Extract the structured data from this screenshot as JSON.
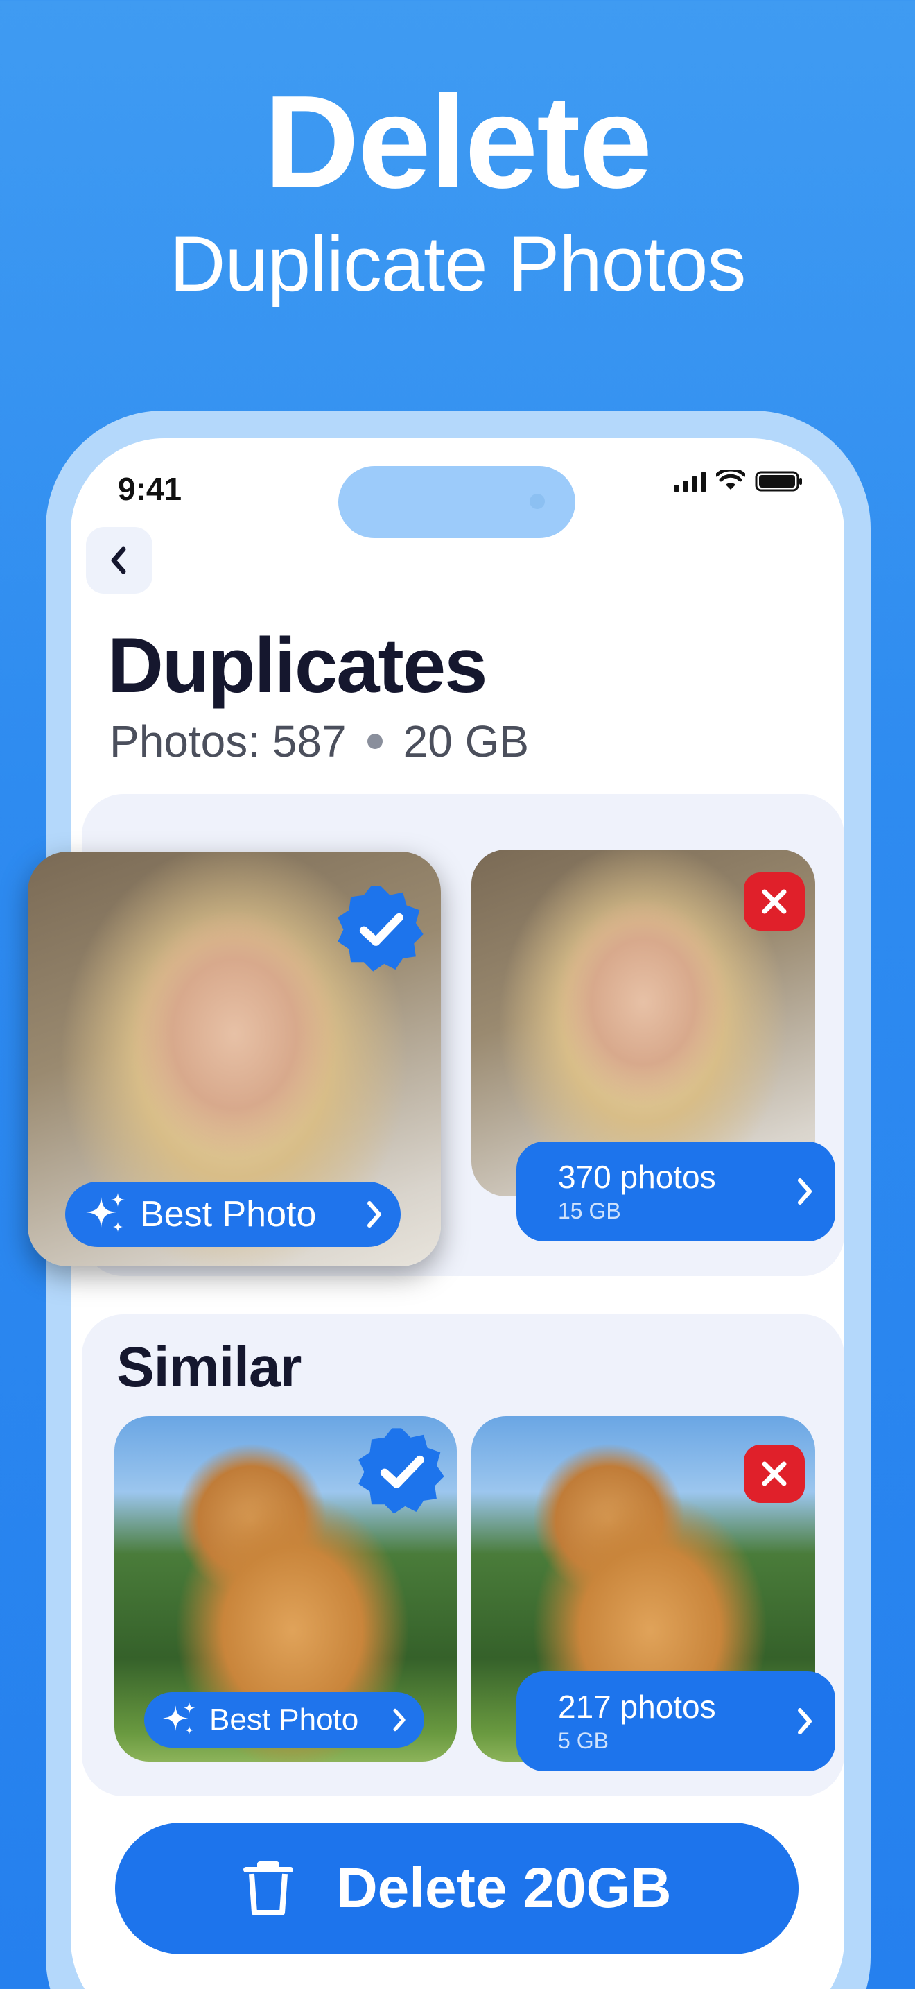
{
  "promo": {
    "title": "Delete",
    "subtitle": "Duplicate Photos"
  },
  "status_bar": {
    "time": "9:41",
    "icons": [
      "signal-icon",
      "wifi-icon",
      "battery-icon"
    ]
  },
  "nav": {
    "back_icon": "chevron-left-icon"
  },
  "screen": {
    "title": "Duplicates",
    "photos_label": "Photos: 587",
    "size_label": "20 GB"
  },
  "duplicates_group": {
    "best_label": "Best Photo",
    "count_label": "370 photos",
    "size_label": "15 GB"
  },
  "similar_group": {
    "title": "Similar",
    "best_label": "Best Photo",
    "count_label": "217 photos",
    "size_label": "5 GB"
  },
  "actions": {
    "delete_label": "Delete 20GB",
    "delete_icon": "trash-icon"
  },
  "colors": {
    "background": "#2e8bf0",
    "accent": "#1d74ec",
    "reject": "#e0202a",
    "card": "#eff2fb",
    "title_text": "#15172e"
  }
}
